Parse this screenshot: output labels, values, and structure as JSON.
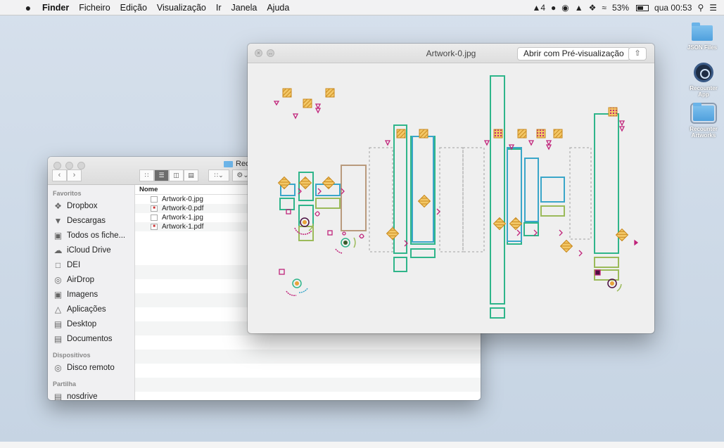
{
  "menubar": {
    "apple": "",
    "app": "Finder",
    "items": [
      "Ficheiro",
      "Edição",
      "Visualização",
      "Ir",
      "Janela",
      "Ajuda"
    ],
    "status": {
      "adobe": "4",
      "battery": "53%",
      "clock": "qua 00:53"
    }
  },
  "desktop": {
    "icons": [
      {
        "label": "JSON Files"
      },
      {
        "label": "Recounter App"
      },
      {
        "label": "Recounter Artworks"
      }
    ]
  },
  "finder": {
    "title": "Recounter Artworks",
    "title_visible": "Rec",
    "column_name": "Nome",
    "files": [
      "Artwork-0.jpg",
      "Artwork-0.pdf",
      "Artwork-1.jpg",
      "Artwork-1.pdf"
    ],
    "sidebar": {
      "favorites_head": "Favoritos",
      "favorites": [
        "Dropbox",
        "Descargas",
        "Todos os fiche...",
        "iCloud Drive",
        "DEI",
        "AirDrop",
        "Imagens",
        "Aplicações",
        "Desktop",
        "Documentos"
      ],
      "devices_head": "Dispositivos",
      "devices": [
        "Disco remoto"
      ],
      "shared_head": "Partilha",
      "shared": [
        "nosdrive"
      ]
    }
  },
  "preview": {
    "title": "Artwork-0.jpg",
    "open_button": "Abrir com Pré-visualização",
    "share_icon": "share-icon"
  },
  "colors": {
    "teal": "#2fb58a",
    "blue": "#3aa6c9",
    "brown": "#b99a7d",
    "magenta": "#c0237a",
    "orange": "#e8a33a",
    "olive": "#9bba5a",
    "gray_dash": "#bbbbbb"
  }
}
